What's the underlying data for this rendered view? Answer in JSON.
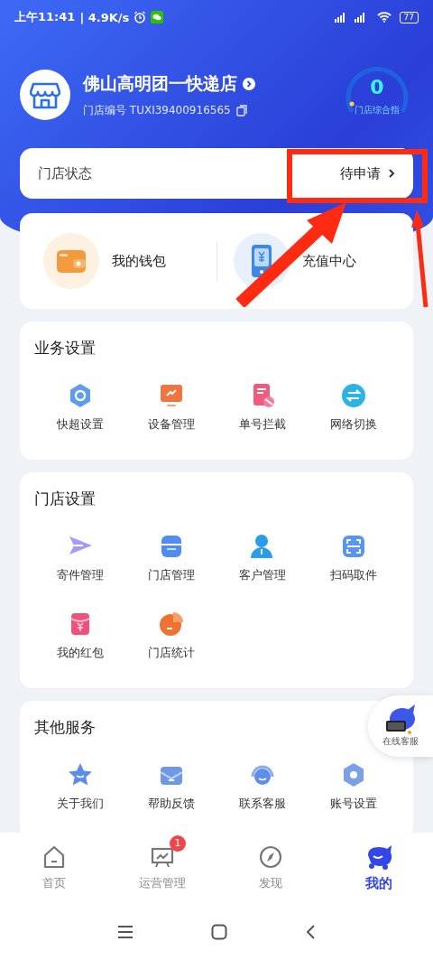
{
  "status_bar": {
    "time": "上午11:41",
    "speed": "| 4.9K/s",
    "battery": "77"
  },
  "store": {
    "name": "佛山高明团一快递店",
    "id_label": "门店编号",
    "id": "TUXI39400916565",
    "score": "0",
    "score_label": "门店综合指"
  },
  "store_status": {
    "label": "门店状态",
    "value": "待申请"
  },
  "wallet_links": [
    {
      "label": "我的钱包"
    },
    {
      "label": "充值中心"
    }
  ],
  "sections": [
    {
      "title": "业务设置",
      "items": [
        {
          "label": "快超设置"
        },
        {
          "label": "设备管理"
        },
        {
          "label": "单号拦截"
        },
        {
          "label": "网络切换"
        }
      ]
    },
    {
      "title": "门店设置",
      "items": [
        {
          "label": "寄件管理"
        },
        {
          "label": "门店管理"
        },
        {
          "label": "客户管理"
        },
        {
          "label": "扫码取件"
        },
        {
          "label": "我的红包"
        },
        {
          "label": "门店统计"
        }
      ]
    },
    {
      "title": "其他服务",
      "items": [
        {
          "label": "关于我们"
        },
        {
          "label": "帮助反馈"
        },
        {
          "label": "联系客服"
        },
        {
          "label": "账号设置"
        }
      ]
    }
  ],
  "online_service": {
    "label": "在线客服"
  },
  "tabs": [
    {
      "label": "首页",
      "selected": false
    },
    {
      "label": "运营管理",
      "selected": false,
      "badge": "1"
    },
    {
      "label": "发现",
      "selected": false
    },
    {
      "label": "我的",
      "selected": true
    }
  ]
}
